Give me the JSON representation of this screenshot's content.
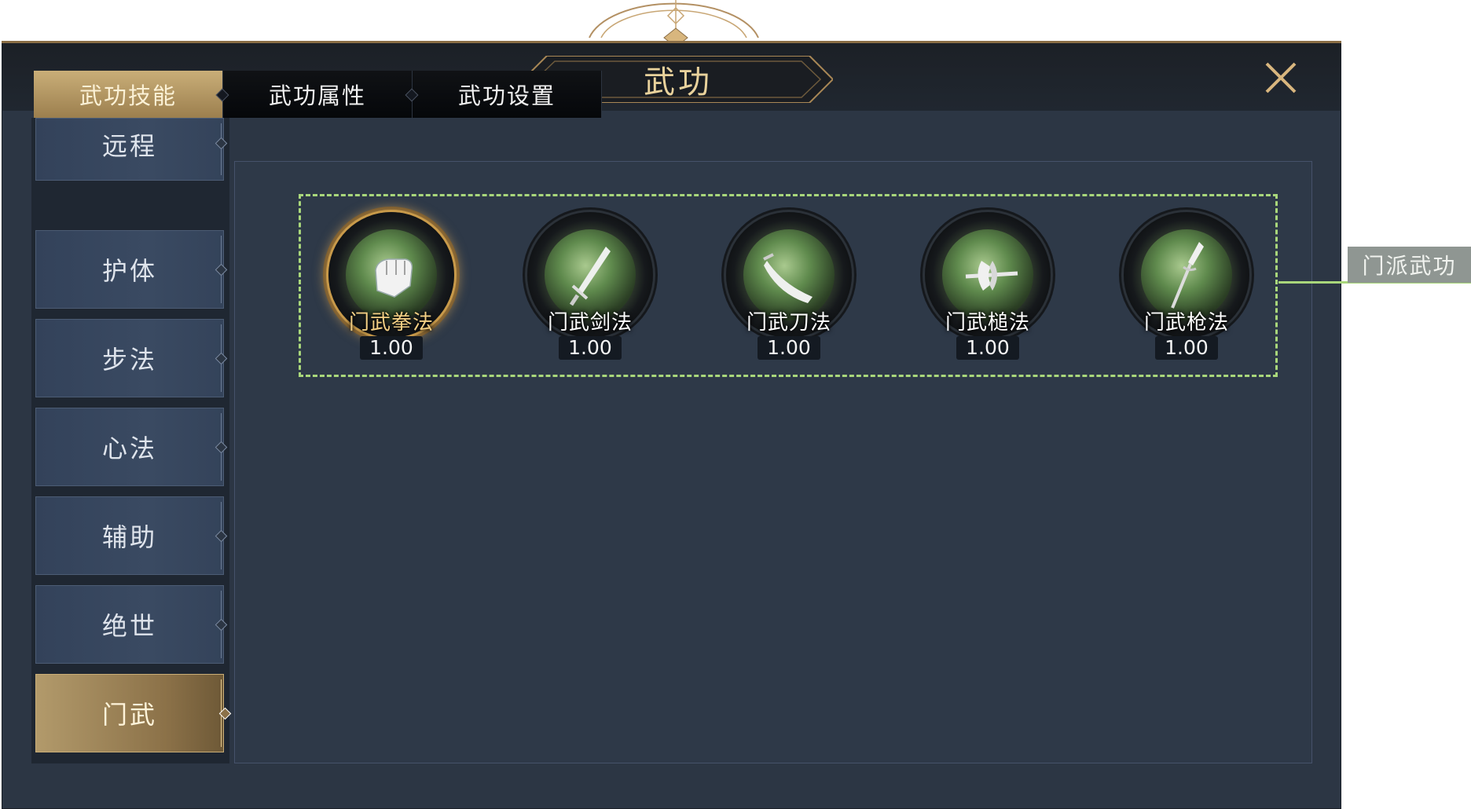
{
  "window": {
    "title": "武功"
  },
  "tabs": [
    {
      "label": "武功技能",
      "active": true
    },
    {
      "label": "武功属性",
      "active": false
    },
    {
      "label": "武功设置",
      "active": false
    }
  ],
  "sidebar": {
    "items": [
      {
        "label": "远程",
        "active": false
      },
      {
        "label": "护体",
        "active": false
      },
      {
        "label": "步法",
        "active": false
      },
      {
        "label": "心法",
        "active": false
      },
      {
        "label": "辅助",
        "active": false
      },
      {
        "label": "绝世",
        "active": false
      },
      {
        "label": "门武",
        "active": true
      }
    ]
  },
  "skills": [
    {
      "name": "门武拳法",
      "value": "1.00",
      "icon": "fist-icon",
      "active": true
    },
    {
      "name": "门武剑法",
      "value": "1.00",
      "icon": "sword-icon",
      "active": false
    },
    {
      "name": "门武刀法",
      "value": "1.00",
      "icon": "blade-icon",
      "active": false
    },
    {
      "name": "门武槌法",
      "value": "1.00",
      "icon": "axe-icon",
      "active": false
    },
    {
      "name": "门武枪法",
      "value": "1.00",
      "icon": "spear-icon",
      "active": false
    }
  ],
  "annotation": {
    "label": "门派武功"
  },
  "colors": {
    "accent_gold": "#e9d29c",
    "annotation_green": "#a9d77b",
    "panel_bg": "#2c3644"
  }
}
